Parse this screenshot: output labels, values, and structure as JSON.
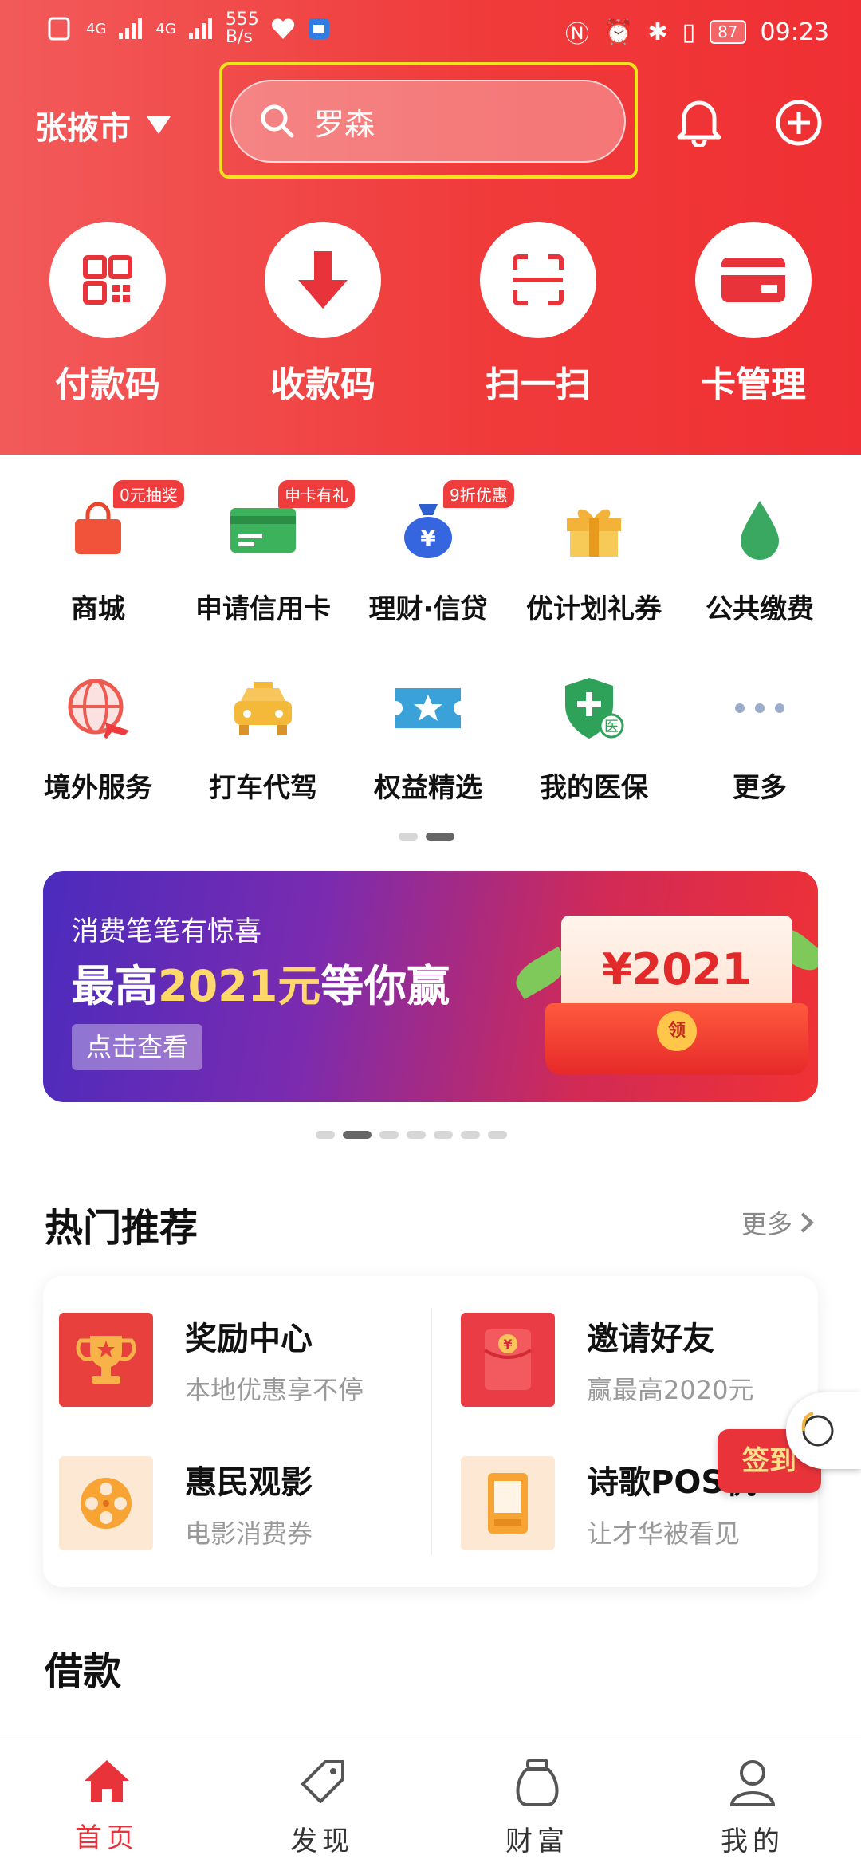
{
  "status_bar": {
    "network": "4G",
    "network2": "4G",
    "speed": "555",
    "speed_unit": "B/s",
    "battery": "87",
    "time": "09:23"
  },
  "header": {
    "city": "张掖市",
    "search_placeholder": "罗森"
  },
  "quick_actions": [
    {
      "label": "付款码",
      "icon": "qr-code-icon"
    },
    {
      "label": "收款码",
      "icon": "down-arrow-icon"
    },
    {
      "label": "扫一扫",
      "icon": "scan-icon"
    },
    {
      "label": "卡管理",
      "icon": "card-icon"
    }
  ],
  "grid": [
    {
      "label": "商城",
      "icon": "shopping-bag-icon",
      "badge": "0元抽奖"
    },
    {
      "label": "申请信用卡",
      "icon": "credit-card-icon",
      "badge": "申卡有礼"
    },
    {
      "label": "理财·信贷",
      "icon": "money-bag-icon",
      "badge": "9折优惠"
    },
    {
      "label": "优计划礼券",
      "icon": "gift-icon",
      "badge": ""
    },
    {
      "label": "公共缴费",
      "icon": "water-drop-icon",
      "badge": ""
    },
    {
      "label": "境外服务",
      "icon": "globe-plane-icon",
      "badge": ""
    },
    {
      "label": "打车代驾",
      "icon": "taxi-icon",
      "badge": ""
    },
    {
      "label": "权益精选",
      "icon": "ticket-star-icon",
      "badge": ""
    },
    {
      "label": "我的医保",
      "icon": "medical-shield-icon",
      "badge": "医"
    },
    {
      "label": "更多",
      "icon": "more-dots-icon",
      "badge": ""
    }
  ],
  "banner": {
    "subtitle": "消费笔笔有惊喜",
    "title_prefix": "最高",
    "title_highlight": "2021元",
    "title_suffix": "等你赢",
    "button": "点击查看",
    "envelope_amount": "¥2021",
    "coin_label": "领"
  },
  "hot": {
    "title": "热门推荐",
    "more": "更多",
    "items": [
      {
        "title": "奖励中心",
        "desc": "本地优惠享不停",
        "icon": "trophy-icon"
      },
      {
        "title": "邀请好友",
        "desc": "赢最高2020元",
        "icon": "red-envelope-icon"
      },
      {
        "title": "惠民观影",
        "desc": "电影消费券",
        "icon": "film-reel-icon"
      },
      {
        "title": "诗歌POS机",
        "desc": "让才华被看见",
        "icon": "pos-machine-icon"
      }
    ]
  },
  "signin": "签到",
  "loan_title": "借款",
  "tabs": [
    {
      "label": "首页",
      "icon": "home-icon"
    },
    {
      "label": "发现",
      "icon": "tag-icon"
    },
    {
      "label": "财富",
      "icon": "wealth-bag-icon"
    },
    {
      "label": "我的",
      "icon": "user-icon"
    }
  ],
  "colors": {
    "brand_red": "#ef3b3b",
    "highlight_yellow": "#f6e31f",
    "active_tab": "#e8333a"
  }
}
